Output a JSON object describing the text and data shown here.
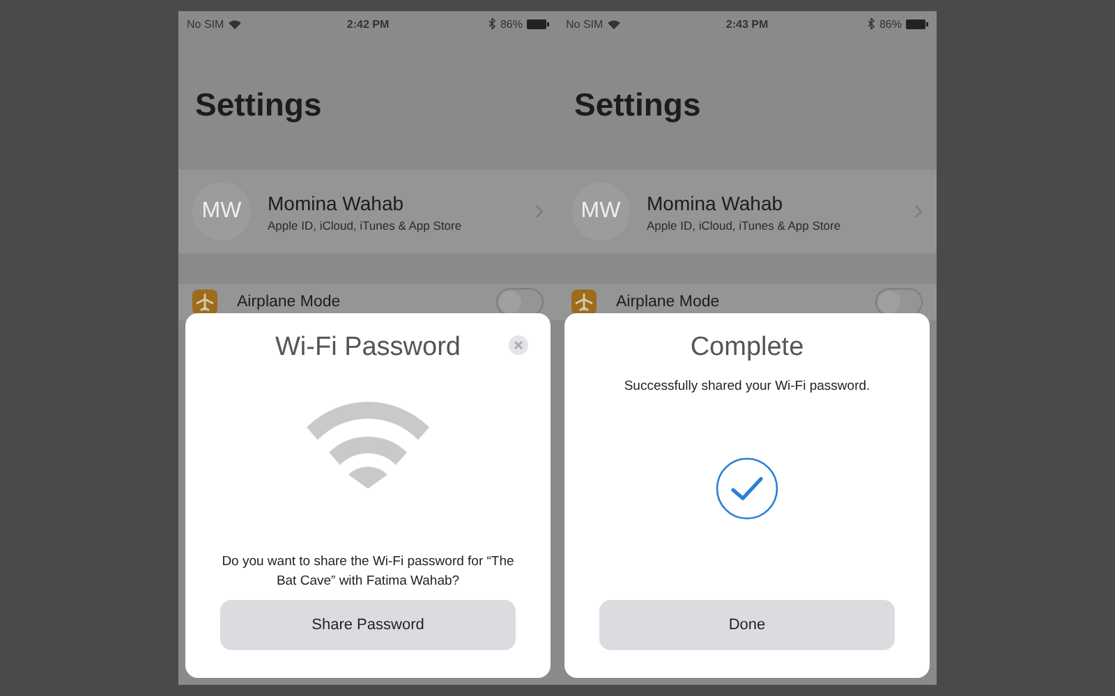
{
  "screens": [
    {
      "status_bar": {
        "carrier": "No SIM",
        "time": "2:42 PM",
        "battery": "86%"
      },
      "title": "Settings",
      "profile": {
        "initials": "MW",
        "name": "Momina Wahab",
        "subtitle": "Apple ID, iCloud, iTunes & App Store"
      },
      "rows": [
        {
          "label": "Airplane Mode",
          "kind": "toggle",
          "on": false
        }
      ],
      "dialog": {
        "kind": "share",
        "title": "Wi-Fi Password",
        "message": "Do you want to share the Wi-Fi password for “The Bat Cave” with Fatima Wahab?",
        "button": "Share Password",
        "closable": true
      }
    },
    {
      "status_bar": {
        "carrier": "No SIM",
        "time": "2:43 PM",
        "battery": "86%"
      },
      "title": "Settings",
      "profile": {
        "initials": "MW",
        "name": "Momina Wahab",
        "subtitle": "Apple ID, iCloud, iTunes & App Store"
      },
      "rows": [
        {
          "label": "Airplane Mode",
          "kind": "toggle",
          "on": false
        }
      ],
      "dialog": {
        "kind": "complete",
        "title": "Complete",
        "message": "Successfully shared your Wi-Fi password.",
        "button": "Done",
        "closable": false
      }
    }
  ]
}
